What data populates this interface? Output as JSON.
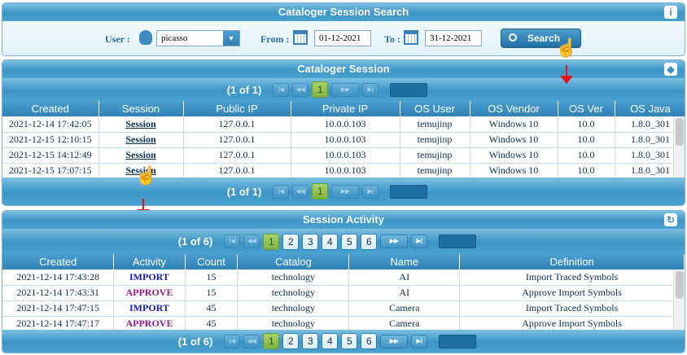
{
  "search_panel": {
    "title": "Cataloger Session Search",
    "info_icon": "info-icon",
    "user_label": "User :",
    "user_value": "picasso",
    "from_label": "From :",
    "from_value": "01-12-2021",
    "to_label": "To :",
    "to_value": "31-12-2021",
    "search_button": "Search"
  },
  "session_panel": {
    "title": "Cataloger Session",
    "pager_text": "(1 of 1)",
    "pages": [
      "1"
    ],
    "columns": [
      "Created",
      "Session",
      "Public IP",
      "Private IP",
      "OS User",
      "OS Vendor",
      "OS Ver",
      "OS Java"
    ],
    "rows": [
      [
        "2021-12-14 17:42:05",
        "Session",
        "127.0.0.1",
        "10.0.0.103",
        "temujinp",
        "Windows 10",
        "10.0",
        "1.8.0_301"
      ],
      [
        "2021-12-15 12:10:15",
        "Session",
        "127.0.0.1",
        "10.0.0.103",
        "temujinp",
        "Windows 10",
        "10.0",
        "1.8.0_301"
      ],
      [
        "2021-12-15 14:12:49",
        "Session",
        "127.0.0.1",
        "10.0.0.103",
        "temujinp",
        "Windows 10",
        "10.0",
        "1.8.0_301"
      ],
      [
        "2021-12-15 17:07:15",
        "Session",
        "127.0.0.1",
        "10.0.0.103",
        "temujinp",
        "Windows 10",
        "10.0",
        "1.8.0_301"
      ]
    ]
  },
  "activity_panel": {
    "title": "Session Activity",
    "pager_text": "(1 of 6)",
    "pages": [
      "1",
      "2",
      "3",
      "4",
      "5",
      "6"
    ],
    "columns": [
      "Created",
      "Activity",
      "Count",
      "Catalog",
      "Name",
      "Definition"
    ],
    "rows": [
      [
        "2021-12-14 17:43:28",
        "IMPORT",
        "15",
        "technology",
        "AI",
        "Import Traced Symbols"
      ],
      [
        "2021-12-14 17:43:31",
        "APPROVE",
        "15",
        "technology",
        "AI",
        "Approve Import Symbols"
      ],
      [
        "2021-12-14 17:47:15",
        "IMPORT",
        "45",
        "technology",
        "Camera",
        "Import Traced Symbols"
      ],
      [
        "2021-12-14 17:47:17",
        "APPROVE",
        "45",
        "technology",
        "Camera",
        "Approve Import Symbols"
      ]
    ],
    "activity_colors": {
      "IMPORT": "#1a1ab8",
      "APPROVE": "#9b1a8f"
    }
  },
  "colors": {
    "accent": "#3b95c6",
    "arrow": "#e8111a",
    "active_page": "#8cc04d"
  }
}
